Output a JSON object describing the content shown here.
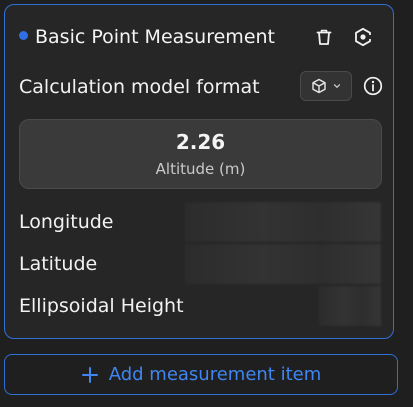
{
  "measurement": {
    "title": "Basic Point Measurement",
    "accent_color": "#2f6fe3",
    "actions": {
      "delete_icon": "trash-icon",
      "focus_icon": "focus-target-icon"
    }
  },
  "format": {
    "label": "Calculation model format",
    "selected_icon": "cube-icon",
    "dropdown_icon": "chevron-down-icon",
    "info_icon": "info-icon"
  },
  "altitude": {
    "value": "2.26",
    "label": "Altitude (m)"
  },
  "coordinates": [
    {
      "label": "Longitude"
    },
    {
      "label": "Latitude"
    },
    {
      "label": "Ellipsoidal Height"
    }
  ],
  "add_button": {
    "label": "Add measurement item",
    "icon": "plus-icon",
    "color": "#3f86f2"
  }
}
